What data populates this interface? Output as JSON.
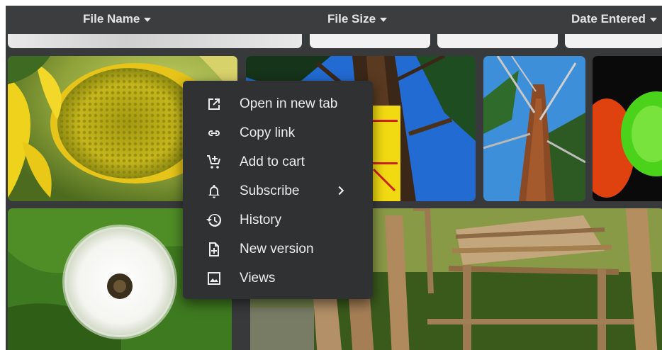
{
  "columns": [
    {
      "label": "File Name"
    },
    {
      "label": "File Size"
    },
    {
      "label": "Date Entered"
    }
  ],
  "context_menu": {
    "items": [
      {
        "label": "Open in new tab",
        "icon": "open-in-new-icon"
      },
      {
        "label": "Copy link",
        "icon": "link-icon"
      },
      {
        "label": "Add to cart",
        "icon": "add-cart-icon"
      },
      {
        "label": "Subscribe",
        "icon": "bell-icon",
        "has_submenu": true
      },
      {
        "label": "History",
        "icon": "history-icon"
      },
      {
        "label": "New version",
        "icon": "file-plus-icon"
      },
      {
        "label": "Views",
        "icon": "image-icon"
      }
    ]
  },
  "tiles": [
    {
      "subject": "sunflower"
    },
    {
      "subject": "pine-tree-sign"
    },
    {
      "subject": "tree-trunk"
    },
    {
      "subject": "green-fuzz"
    },
    {
      "subject": "dandelion"
    },
    {
      "subject": "wooden-shelter"
    }
  ],
  "theme": {
    "background": "#38393b",
    "header": "#3c3d3f",
    "menu": "#303133",
    "text": "#ececec"
  }
}
